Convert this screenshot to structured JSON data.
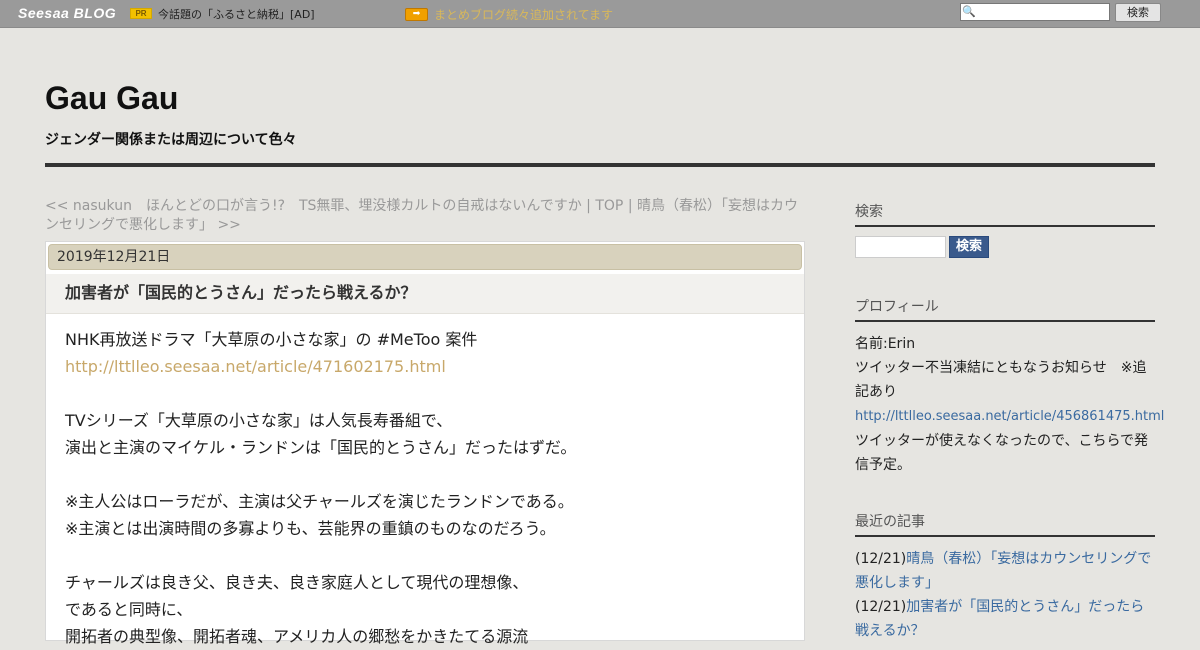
{
  "topbar": {
    "logo": "Seesaa BLOG",
    "pr_badge": "PR",
    "pr_text": "今話題の「ふるさと納税」[AD]",
    "arrow": "➡",
    "news_link": "まとめブログ続々追加されてます",
    "search_button": "検索"
  },
  "header": {
    "title": "Gau Gau",
    "description": "ジェンダー関係または周辺について色々"
  },
  "post_nav": {
    "prev": "<< nasukun　ほんとどの口が言う!?　TS無罪、埋没様カルトの自戒はないんですか",
    "sep1": " | ",
    "top": "TOP",
    "sep2": " | ",
    "next": "晴鳥（春松）「妄想はカウンセリングで悪化します」 >>"
  },
  "article": {
    "date": "2019年12月21日",
    "title": "加害者が「国民的とうさん」だったら戦えるか？",
    "lines": [
      "NHK再放送ドラマ「大草原の小さな家」の #MeToo 案件",
      "http://lttlleo.seesaa.net/article/471602175.html",
      "",
      "TVシリーズ「大草原の小さな家」は人気長寿番組で、",
      "演出と主演のマイケル・ランドンは「国民的とうさん」だったはずだ。",
      "",
      "※主人公はローラだが、主演は父チャールズを演じたランドンである。",
      "※主演とは出演時間の多寡よりも、芸能界の重鎮のものなのだろう。",
      "",
      "チャールズは良き父、良き夫、良き家庭人として現代の理想像、",
      "であると同時に、",
      "開拓者の典型像、開拓者魂、アメリカ人の郷愁をかきたてる源流"
    ]
  },
  "sidebar": {
    "search": {
      "heading": "検索",
      "button": "検索"
    },
    "profile": {
      "heading": "プロフィール",
      "name": "名前:Erin",
      "notice": "ツイッター不当凍結にともなうお知らせ　※追記あり",
      "link": "http://lttlleo.seesaa.net/article/456861475.html",
      "note": "ツイッターが使えなくなったので、こちらで発信予定。"
    },
    "recent": {
      "heading": "最近の記事",
      "items": [
        {
          "date": "(12/21)",
          "title": "晴鳥（春松）「妄想はカウンセリングで悪化します」"
        },
        {
          "date": "(12/21)",
          "title": "加害者が「国民的とうさん」だったら戦えるか？"
        }
      ]
    }
  }
}
